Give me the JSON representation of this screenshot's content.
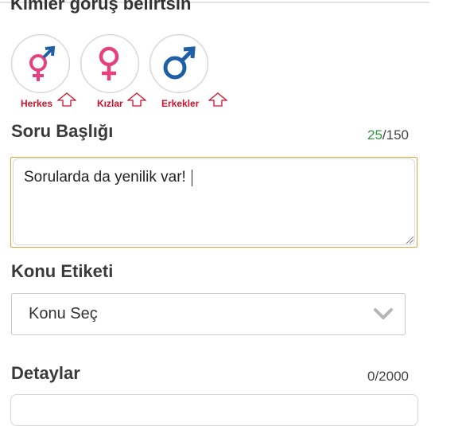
{
  "audience": {
    "title": "Kimler görüş belirtsin",
    "options": [
      {
        "label": "Herkes",
        "icon": "male-female-icon"
      },
      {
        "label": "Kızlar",
        "icon": "female-icon"
      },
      {
        "label": "Erkekler",
        "icon": "male-icon"
      }
    ]
  },
  "question_title": {
    "label": "Soru Başlığı",
    "counter_used": "25",
    "counter_max": "/150",
    "value": "Sorularda da yenilik var!"
  },
  "topic": {
    "label": "Konu Etiketi",
    "selected": "Konu Seç"
  },
  "details": {
    "label": "Detaylar",
    "counter": "0/2000"
  },
  "colors": {
    "accent_orange": "#e8a33a",
    "gender_label_red": "#d0112b",
    "female_pink": "#e8407c",
    "male_blue": "#1f5fa8",
    "counter_green": "#2e9a3a"
  }
}
